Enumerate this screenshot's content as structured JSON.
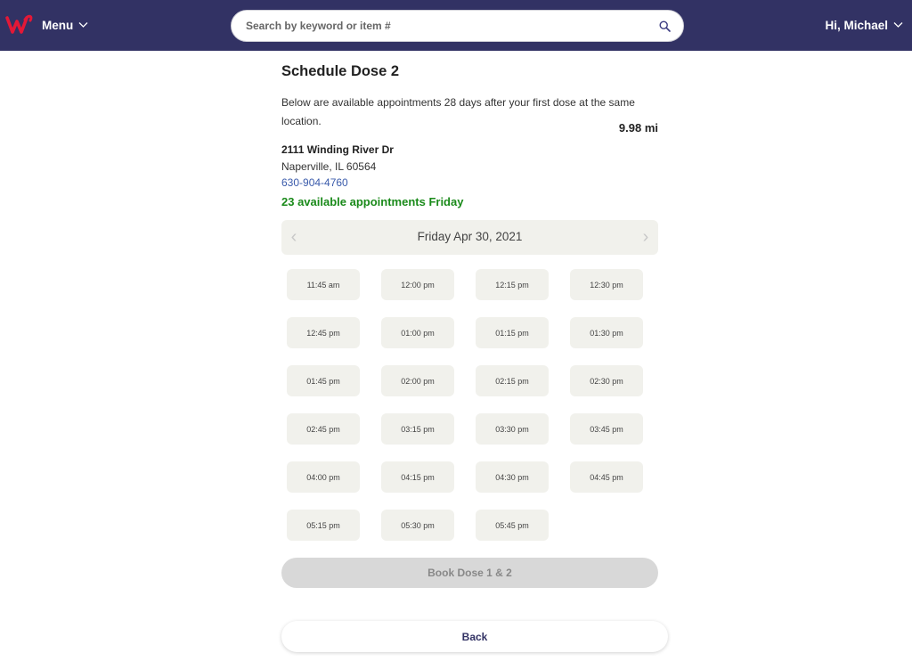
{
  "header": {
    "menu_label": "Menu",
    "search_placeholder": "Search by keyword or item #",
    "search_value": "",
    "greeting": "Hi, Michael",
    "brand_color": "#323264",
    "logo_color": "#e31837"
  },
  "schedule": {
    "title": "Schedule Dose 2",
    "description": "Below are available appointments 28 days after your first dose at the same location.",
    "distance": "9.98 mi",
    "address_line1": "2111 Winding River Dr",
    "address_line2": "Naperville, IL 60564",
    "phone": "630-904-4760",
    "availability": "23 available appointments Friday",
    "date_label": "Friday Apr 30, 2021",
    "prev_icon": "chevron-left-icon",
    "next_icon": "chevron-right-icon"
  },
  "slots": [
    "11:45 am",
    "12:00 pm",
    "12:15 pm",
    "12:30 pm",
    "12:45 pm",
    "01:00 pm",
    "01:15 pm",
    "01:30 pm",
    "01:45 pm",
    "02:00 pm",
    "02:15 pm",
    "02:30 pm",
    "02:45 pm",
    "03:15 pm",
    "03:30 pm",
    "03:45 pm",
    "04:00 pm",
    "04:15 pm",
    "04:30 pm",
    "04:45 pm",
    "05:15 pm",
    "05:30 pm",
    "05:45 pm"
  ],
  "actions": {
    "book_label": "Book Dose 1 & 2",
    "back_label": "Back"
  }
}
